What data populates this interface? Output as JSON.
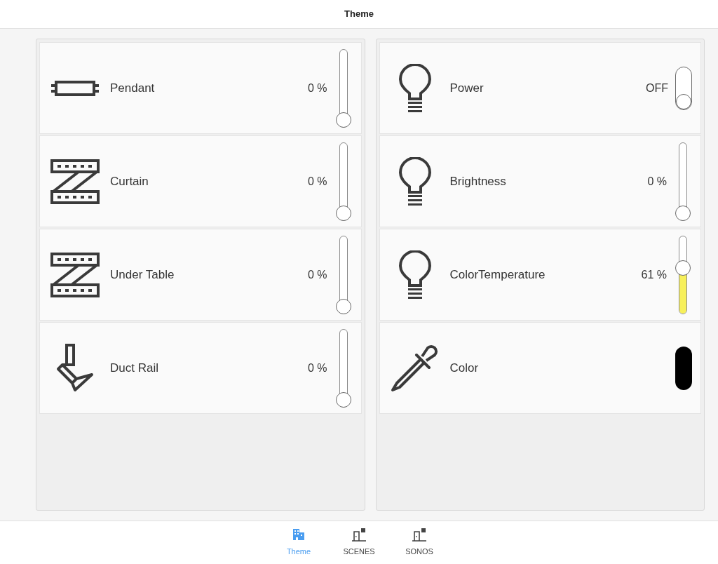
{
  "header": {
    "title": "Theme"
  },
  "panels": [
    {
      "items": [
        {
          "kind": "slider",
          "label": "Pendant",
          "reading": "0 %",
          "level": 0
        },
        {
          "kind": "slider",
          "label": "Curtain",
          "reading": "0 %",
          "level": 0
        },
        {
          "kind": "slider",
          "label": "Under Table",
          "reading": "0 %",
          "level": 0
        },
        {
          "kind": "slider",
          "label": "Duct Rail",
          "reading": "0 %",
          "level": 0
        }
      ]
    },
    {
      "items": [
        {
          "kind": "toggle",
          "label": "Power",
          "reading": "OFF",
          "on": false
        },
        {
          "kind": "slider",
          "label": "Brightness",
          "reading": "0 %",
          "level": 0
        },
        {
          "kind": "slider",
          "label": "ColorTemperature",
          "reading": "61 %",
          "level": 0.61
        },
        {
          "kind": "color",
          "label": "Color",
          "color": "#000000"
        }
      ]
    }
  ],
  "nav": [
    {
      "label": "Theme",
      "selected": true
    },
    {
      "label": "SCENES",
      "selected": false
    },
    {
      "label": "SONOS",
      "selected": false
    }
  ]
}
